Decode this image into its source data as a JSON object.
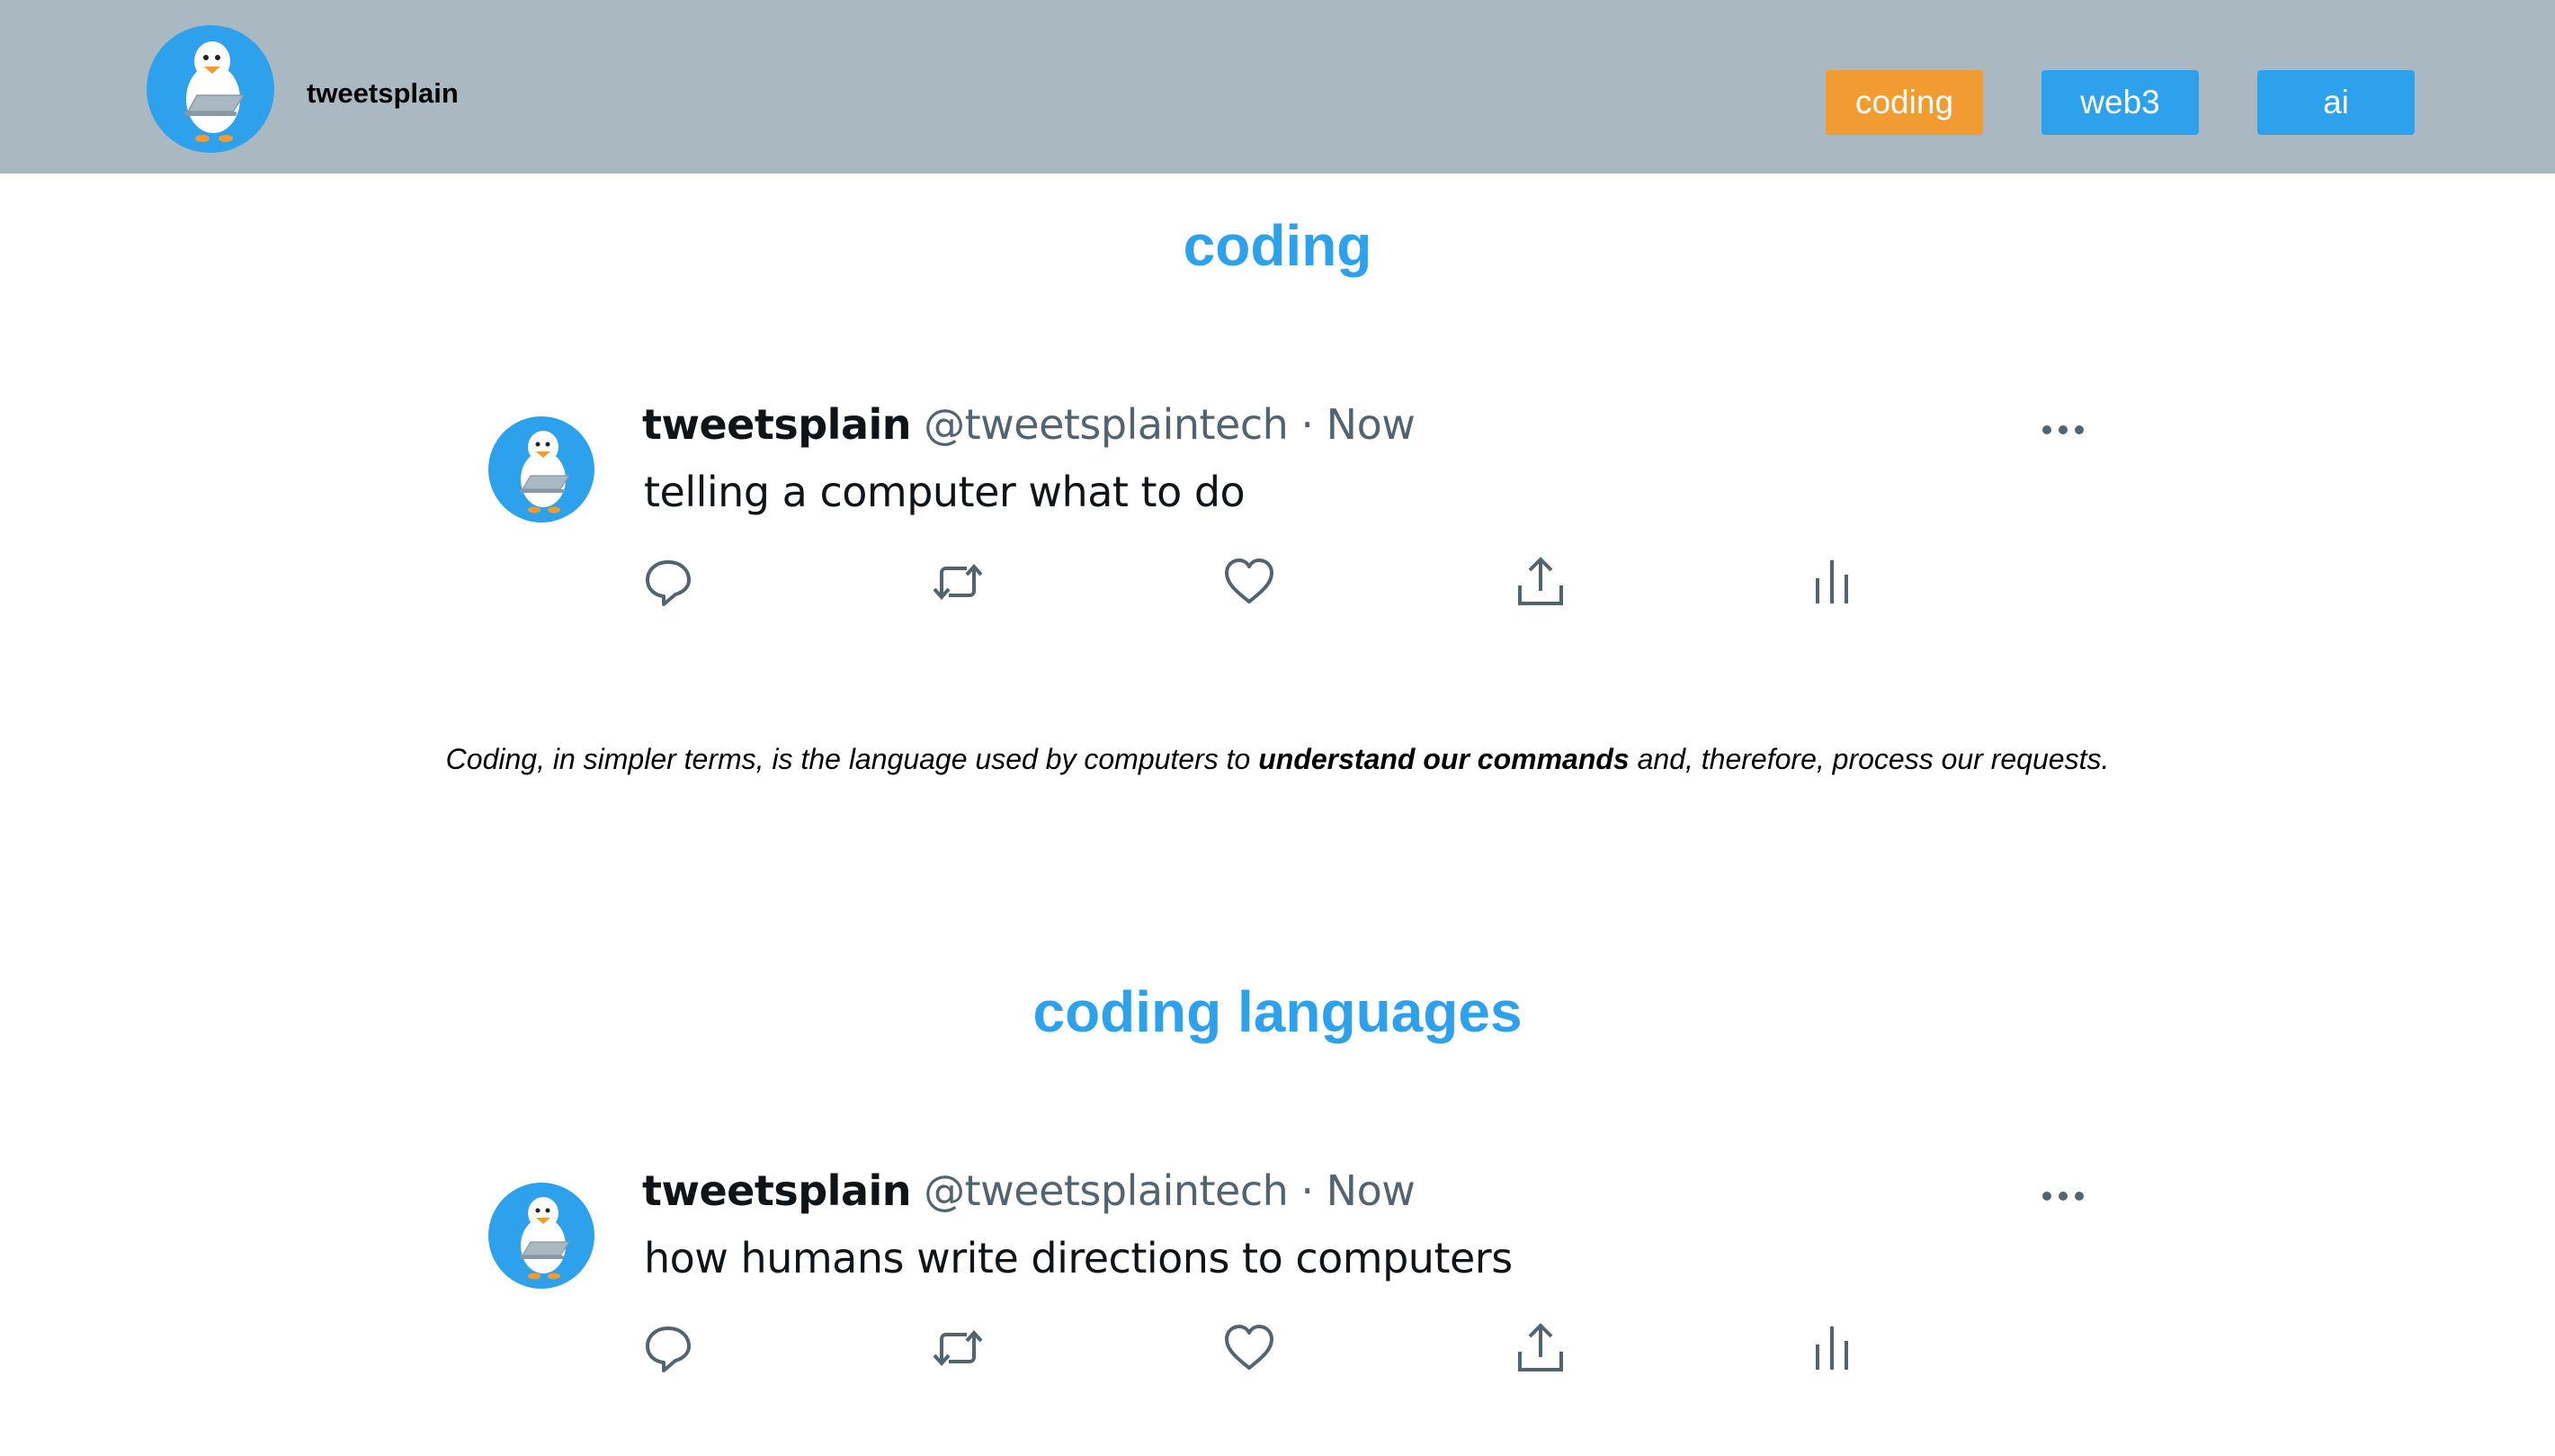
{
  "app": {
    "name": "tweetsplain"
  },
  "nav": [
    {
      "label": "coding",
      "color": "#f29b31",
      "active": true
    },
    {
      "label": "web3",
      "color": "#2ea1ec",
      "active": false
    },
    {
      "label": "ai",
      "color": "#2ea1ec",
      "active": false
    }
  ],
  "sections": [
    {
      "title": "coding",
      "tweet": {
        "name": "tweetsplain",
        "handle": "@tweetsplaintech",
        "separator": " · ",
        "time": "Now",
        "text": "telling a computer what to do",
        "actions": [
          "reply-icon",
          "retweet-icon",
          "like-icon",
          "share-icon",
          "analytics-icon"
        ]
      },
      "explanation": {
        "before": "Coding, in simpler terms, is the language used by computers to ",
        "bold": "understand our commands",
        "after": " and, therefore, process our requests."
      }
    },
    {
      "title": "coding languages",
      "tweet": {
        "name": "tweetsplain",
        "handle": "@tweetsplaintech",
        "separator": " · ",
        "time": "Now",
        "text": "how humans write directions to computers",
        "actions": [
          "reply-icon",
          "retweet-icon",
          "like-icon",
          "share-icon",
          "analytics-icon"
        ]
      }
    }
  ],
  "colors": {
    "header_bg": "#aab8c2",
    "accent_blue": "#2ea1ec",
    "accent_orange": "#f29b31",
    "icon_gray": "#536471"
  }
}
